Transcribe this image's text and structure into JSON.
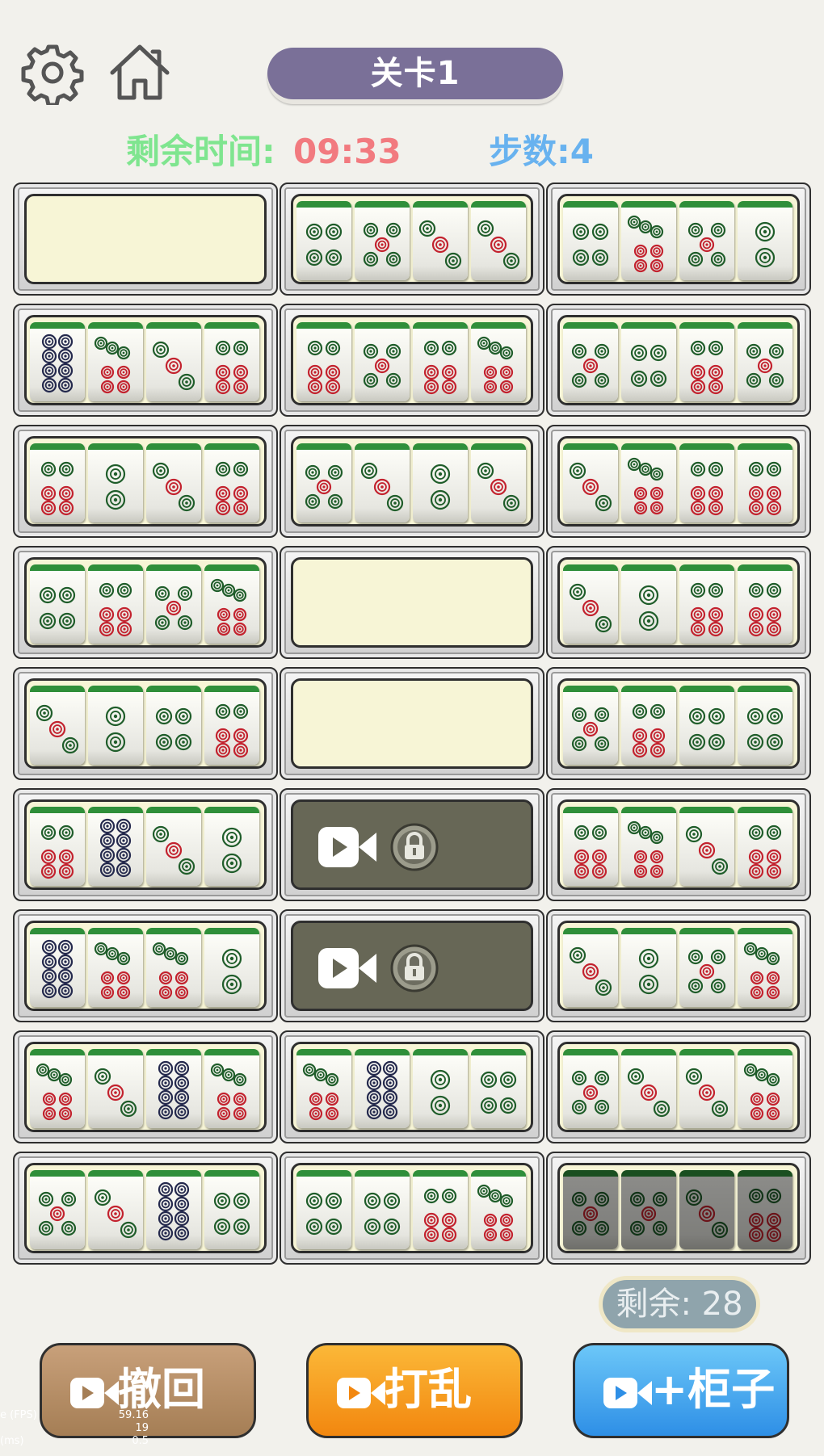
{
  "header": {
    "settings_icon": "gear-icon",
    "home_icon": "home-icon",
    "level": "关卡1",
    "time_label": "剩余时间:",
    "time_value": "09:33",
    "steps_label": "步数:4"
  },
  "tile_colors": {
    "green": "#1f5d2a",
    "red": "#c3222e",
    "navy": "#24294d"
  },
  "cabinets": [
    {
      "state": "empty",
      "tiles": []
    },
    {
      "state": "open",
      "tiles": [
        4,
        5,
        3,
        3
      ]
    },
    {
      "state": "open",
      "tiles": [
        4,
        7,
        5,
        2
      ]
    },
    {
      "state": "open",
      "tiles": [
        8,
        7,
        3,
        6
      ]
    },
    {
      "state": "open",
      "tiles": [
        6,
        5,
        6,
        7
      ]
    },
    {
      "state": "open",
      "tiles": [
        5,
        4,
        6,
        5
      ]
    },
    {
      "state": "open",
      "tiles": [
        6,
        2,
        3,
        6
      ]
    },
    {
      "state": "open",
      "tiles": [
        5,
        3,
        2,
        3
      ]
    },
    {
      "state": "open",
      "tiles": [
        3,
        7,
        6,
        6
      ]
    },
    {
      "state": "open",
      "tiles": [
        4,
        6,
        5,
        7
      ]
    },
    {
      "state": "empty",
      "tiles": []
    },
    {
      "state": "open",
      "tiles": [
        3,
        2,
        6,
        6
      ]
    },
    {
      "state": "open",
      "tiles": [
        3,
        2,
        4,
        6
      ]
    },
    {
      "state": "empty",
      "tiles": []
    },
    {
      "state": "open",
      "tiles": [
        5,
        6,
        4,
        4
      ]
    },
    {
      "state": "open",
      "tiles": [
        6,
        8,
        3,
        2
      ]
    },
    {
      "state": "locked",
      "tiles": []
    },
    {
      "state": "open",
      "tiles": [
        6,
        7,
        3,
        6
      ]
    },
    {
      "state": "open",
      "tiles": [
        8,
        7,
        7,
        2
      ]
    },
    {
      "state": "locked",
      "tiles": []
    },
    {
      "state": "open",
      "tiles": [
        3,
        2,
        5,
        7
      ]
    },
    {
      "state": "open",
      "tiles": [
        7,
        3,
        8,
        7
      ]
    },
    {
      "state": "open",
      "tiles": [
        7,
        8,
        2,
        4
      ]
    },
    {
      "state": "open",
      "tiles": [
        5,
        3,
        3,
        7
      ]
    },
    {
      "state": "open",
      "tiles": [
        5,
        3,
        8,
        4
      ]
    },
    {
      "state": "open",
      "tiles": [
        4,
        4,
        6,
        7
      ]
    },
    {
      "state": "dim",
      "tiles": [
        5,
        5,
        3,
        6
      ]
    }
  ],
  "locked_icons": [
    "video-icon",
    "lock-icon"
  ],
  "remaining": "剩余: 28",
  "buttons": {
    "undo": "撤回",
    "shuffle": "打乱",
    "add_cabinet": "+柜子"
  },
  "debug": {
    "fps_label": "e (FPS)",
    "fps_value": "59.16",
    "row2_label": "",
    "row2_value": "19",
    "row3_label": "(ms)",
    "row3_value": "0.5"
  }
}
